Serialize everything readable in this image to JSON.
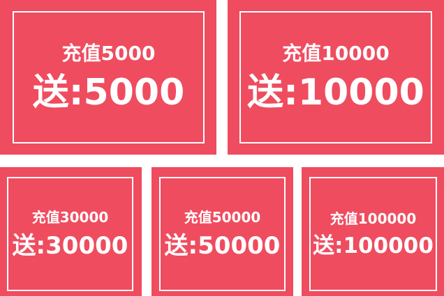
{
  "colors": {
    "card_background": "#ef4c5f",
    "frame_border": "#ffffff",
    "text": "#ffffff",
    "page_background": "#ffffff"
  },
  "cards": [
    {
      "recharge": "充值5000",
      "bonus": "送:5000"
    },
    {
      "recharge": "充值10000",
      "bonus": "送:10000"
    },
    {
      "recharge": "充值30000",
      "bonus": "送:30000"
    },
    {
      "recharge": "充值50000",
      "bonus": "送:50000"
    },
    {
      "recharge": "充值100000",
      "bonus": "送:100000"
    }
  ]
}
